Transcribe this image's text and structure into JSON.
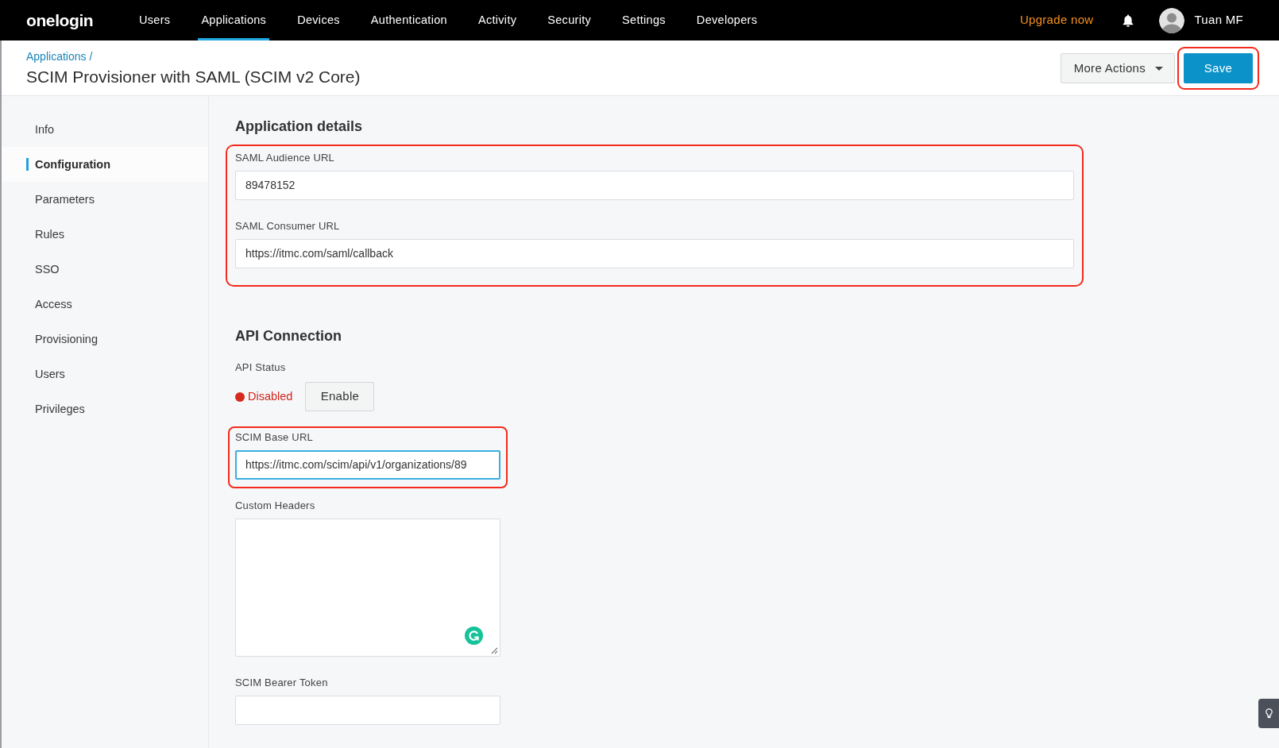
{
  "top_nav": {
    "logo": "onelogin",
    "items": [
      {
        "label": "Users",
        "selected": false
      },
      {
        "label": "Applications",
        "selected": true
      },
      {
        "label": "Devices",
        "selected": false
      },
      {
        "label": "Authentication",
        "selected": false
      },
      {
        "label": "Activity",
        "selected": false
      },
      {
        "label": "Security",
        "selected": false
      },
      {
        "label": "Settings",
        "selected": false
      },
      {
        "label": "Developers",
        "selected": false
      }
    ],
    "upgrade_link": "Upgrade now",
    "user_name": "Tuan MF"
  },
  "header": {
    "breadcrumb": "Applications /",
    "title": "SCIM Provisioner with SAML (SCIM v2 Core)",
    "buttons": [
      {
        "label": "More Actions",
        "kind": "dropdown",
        "highlighted": false
      },
      {
        "label": "Save",
        "kind": "primary",
        "highlighted": true
      }
    ]
  },
  "sidebar": {
    "items": [
      {
        "label": "Info",
        "selected": false
      },
      {
        "label": "Configuration",
        "selected": true
      },
      {
        "label": "Parameters",
        "selected": false
      },
      {
        "label": "Rules",
        "selected": false
      },
      {
        "label": "SSO",
        "selected": false
      },
      {
        "label": "Access",
        "selected": false
      },
      {
        "label": "Provisioning",
        "selected": false
      },
      {
        "label": "Users",
        "selected": false
      },
      {
        "label": "Privileges",
        "selected": false
      }
    ]
  },
  "sections": [
    {
      "title": "Application details",
      "highlighted": true,
      "fields": [
        {
          "kind": "text",
          "label": "SAML Audience URL",
          "value": "89478152",
          "focused": false,
          "highlighted": false
        },
        {
          "kind": "text",
          "label": "SAML Consumer URL",
          "value": "https://itmc.com/saml/callback",
          "focused": false,
          "highlighted": false
        }
      ]
    },
    {
      "title": "API Connection",
      "highlighted": false,
      "fields": [
        {
          "kind": "status",
          "label": "API Status",
          "enabled": false,
          "status": "Disabled",
          "button": "Enable",
          "highlighted": false
        },
        {
          "kind": "text",
          "label": "SCIM Base URL",
          "value": "https://itmc.com/scim/api/v1/organizations/89",
          "focused": true,
          "highlighted": true
        },
        {
          "kind": "textarea",
          "label": "Custom Headers",
          "focused": false,
          "highlighted": false
        },
        {
          "kind": "text",
          "label": "SCIM Bearer Token",
          "focused": false,
          "highlighted": false
        }
      ]
    }
  ]
}
